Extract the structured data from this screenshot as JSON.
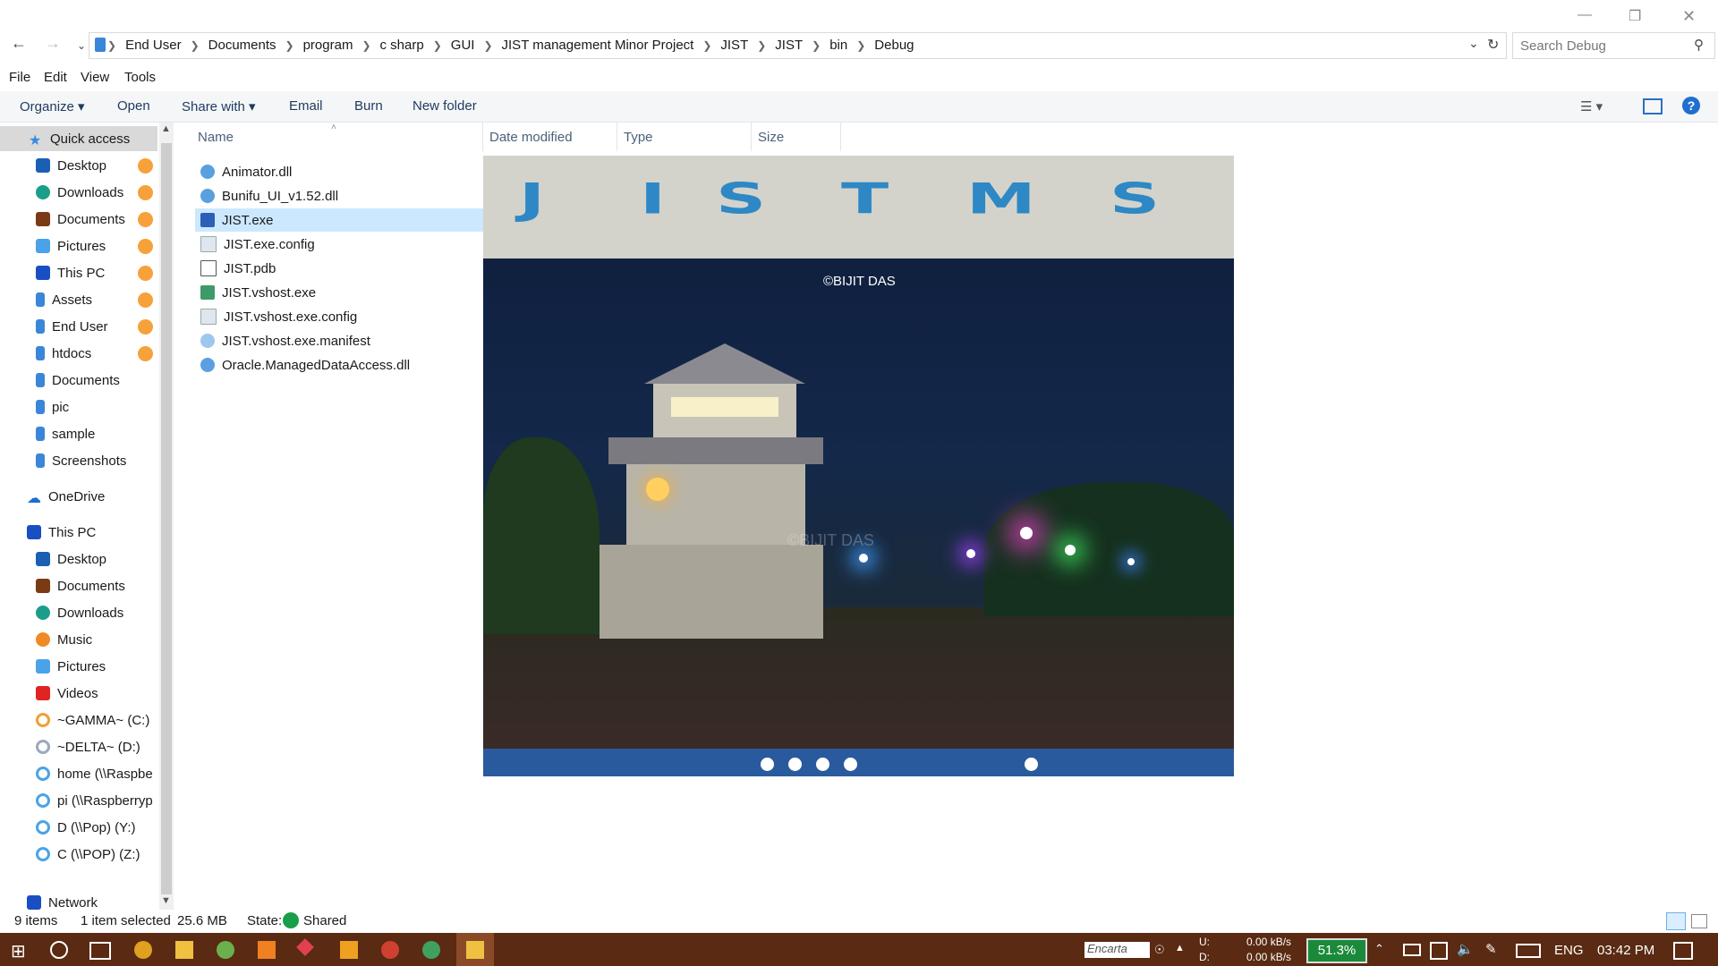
{
  "window": {
    "breadcrumb": [
      "End User",
      "Documents",
      "program",
      "c sharp",
      "GUI",
      "JIST management Minor Project",
      "JIST",
      "JIST",
      "bin",
      "Debug"
    ],
    "search_placeholder": "Search Debug"
  },
  "menu": [
    "File",
    "Edit",
    "View",
    "Tools"
  ],
  "commands": {
    "organize": "Organize",
    "open": "Open",
    "share": "Share with",
    "email": "Email",
    "burn": "Burn",
    "newfolder": "New folder"
  },
  "nav": {
    "quick_access": "Quick access",
    "quick_items": [
      "Desktop",
      "Downloads",
      "Documents",
      "Pictures",
      "This PC",
      "Assets",
      "End User",
      "htdocs",
      "Documents",
      "pic",
      "sample",
      "Screenshots"
    ],
    "onedrive": "OneDrive",
    "thispc": "This PC",
    "pc_items": [
      "Desktop",
      "Documents",
      "Downloads",
      "Music",
      "Pictures",
      "Videos",
      "~GAMMA~ (C:)",
      "~DELTA~ (D:)",
      "home (\\\\Raspbe",
      "pi (\\\\Raspberryp",
      "D (\\\\Pop) (Y:)",
      "C (\\\\POP) (Z:)"
    ],
    "network": "Network"
  },
  "columns": {
    "name": "Name",
    "date": "Date modified",
    "type": "Type",
    "size": "Size"
  },
  "files": [
    "Animator.dll",
    "Bunifu_UI_v1.52.dll",
    "JIST.exe",
    "JIST.exe.config",
    "JIST.pdb",
    "JIST.vshost.exe",
    "JIST.vshost.exe.config",
    "JIST.vshost.exe.manifest",
    "Oracle.ManagedDataAccess.dll"
  ],
  "selected_file_index": 2,
  "preview": {
    "banner_letters": [
      "J",
      "I",
      "S",
      "T",
      "M",
      "S"
    ],
    "copyright": "©BIJIT  DAS",
    "watermark": "©BIJIT  DAS"
  },
  "status": {
    "items": "9 items",
    "selected": "1 item selected",
    "size": "25.6 MB",
    "state_label": "State:",
    "state_value": "Shared"
  },
  "taskbar": {
    "encarta": "Encarta",
    "net_up_label": "U:",
    "net_down_label": "D:",
    "up": "0.00 kB/s",
    "down": "0.00 kB/s",
    "cpu": "51.3%",
    "lang": "ENG",
    "time": "03:42 PM"
  }
}
